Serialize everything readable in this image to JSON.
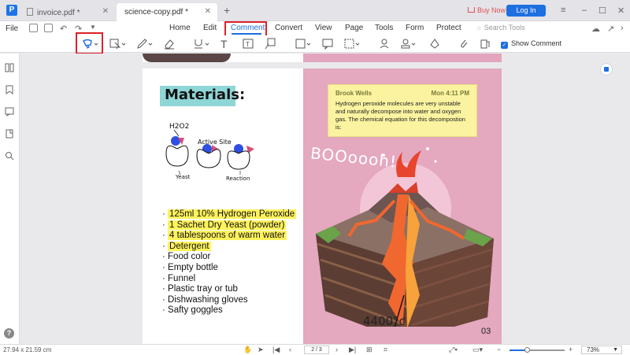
{
  "tabs": [
    {
      "label": "invoice.pdf *"
    },
    {
      "label": "science-copy.pdf *"
    }
  ],
  "header": {
    "buy_now": "Buy Now",
    "login": "Log In"
  },
  "menu": {
    "file": "File",
    "items": [
      "Home",
      "Edit",
      "Comment",
      "Convert",
      "View",
      "Page",
      "Tools",
      "Form",
      "Protect"
    ],
    "active": "Comment",
    "search_placeholder": "Search Tools"
  },
  "toolbar": {
    "show_comment": "Show Comment",
    "show_comment_checked": true
  },
  "document": {
    "heading": "Materials:",
    "diagram_labels": {
      "h2o2": "H2O2",
      "active_site": "Active Site",
      "yeast": "Yeast",
      "reaction": "Reaction"
    },
    "materials_list": [
      {
        "text": "125ml 10% Hydrogen Peroxide",
        "highlighted": true
      },
      {
        "text": "1 Sachet Dry Yeast (powder)",
        "highlighted": true
      },
      {
        "text": "4 tablespoons of warm water",
        "highlighted": true
      },
      {
        "text": "Detergent",
        "highlighted": true
      },
      {
        "text": "Food color",
        "highlighted": false
      },
      {
        "text": "Empty bottle",
        "highlighted": false
      },
      {
        "text": "Funnel",
        "highlighted": false
      },
      {
        "text": "Plastic tray or tub",
        "highlighted": false
      },
      {
        "text": "Dishwashing gloves",
        "highlighted": false
      },
      {
        "text": "Safty goggles",
        "highlighted": false
      }
    ],
    "sticky_note": {
      "author": "Brook Wells",
      "time": "Mon 4:11 PM",
      "text": "Hydrogen peroxide molecules are very unstable and naturally decompose into water and oxygen gas. The chemical equation for this decompostion is:"
    },
    "boom_text": "BOOoooh!",
    "temperature": "4400°c",
    "page_number": "03"
  },
  "statusbar": {
    "dimensions": "27.94 x 21.59 cm",
    "page_indicator": "2 / 3",
    "zoom": "73%",
    "zoom_fraction": 0.33
  },
  "colors": {
    "accent": "#1e6fe0",
    "highlight_box": "#e0202a",
    "highlight_text": "#fff35c",
    "page_pink": "#e4a8bf",
    "heading_bg": "#8fd6d6",
    "sticky": "#fbf3a0"
  }
}
